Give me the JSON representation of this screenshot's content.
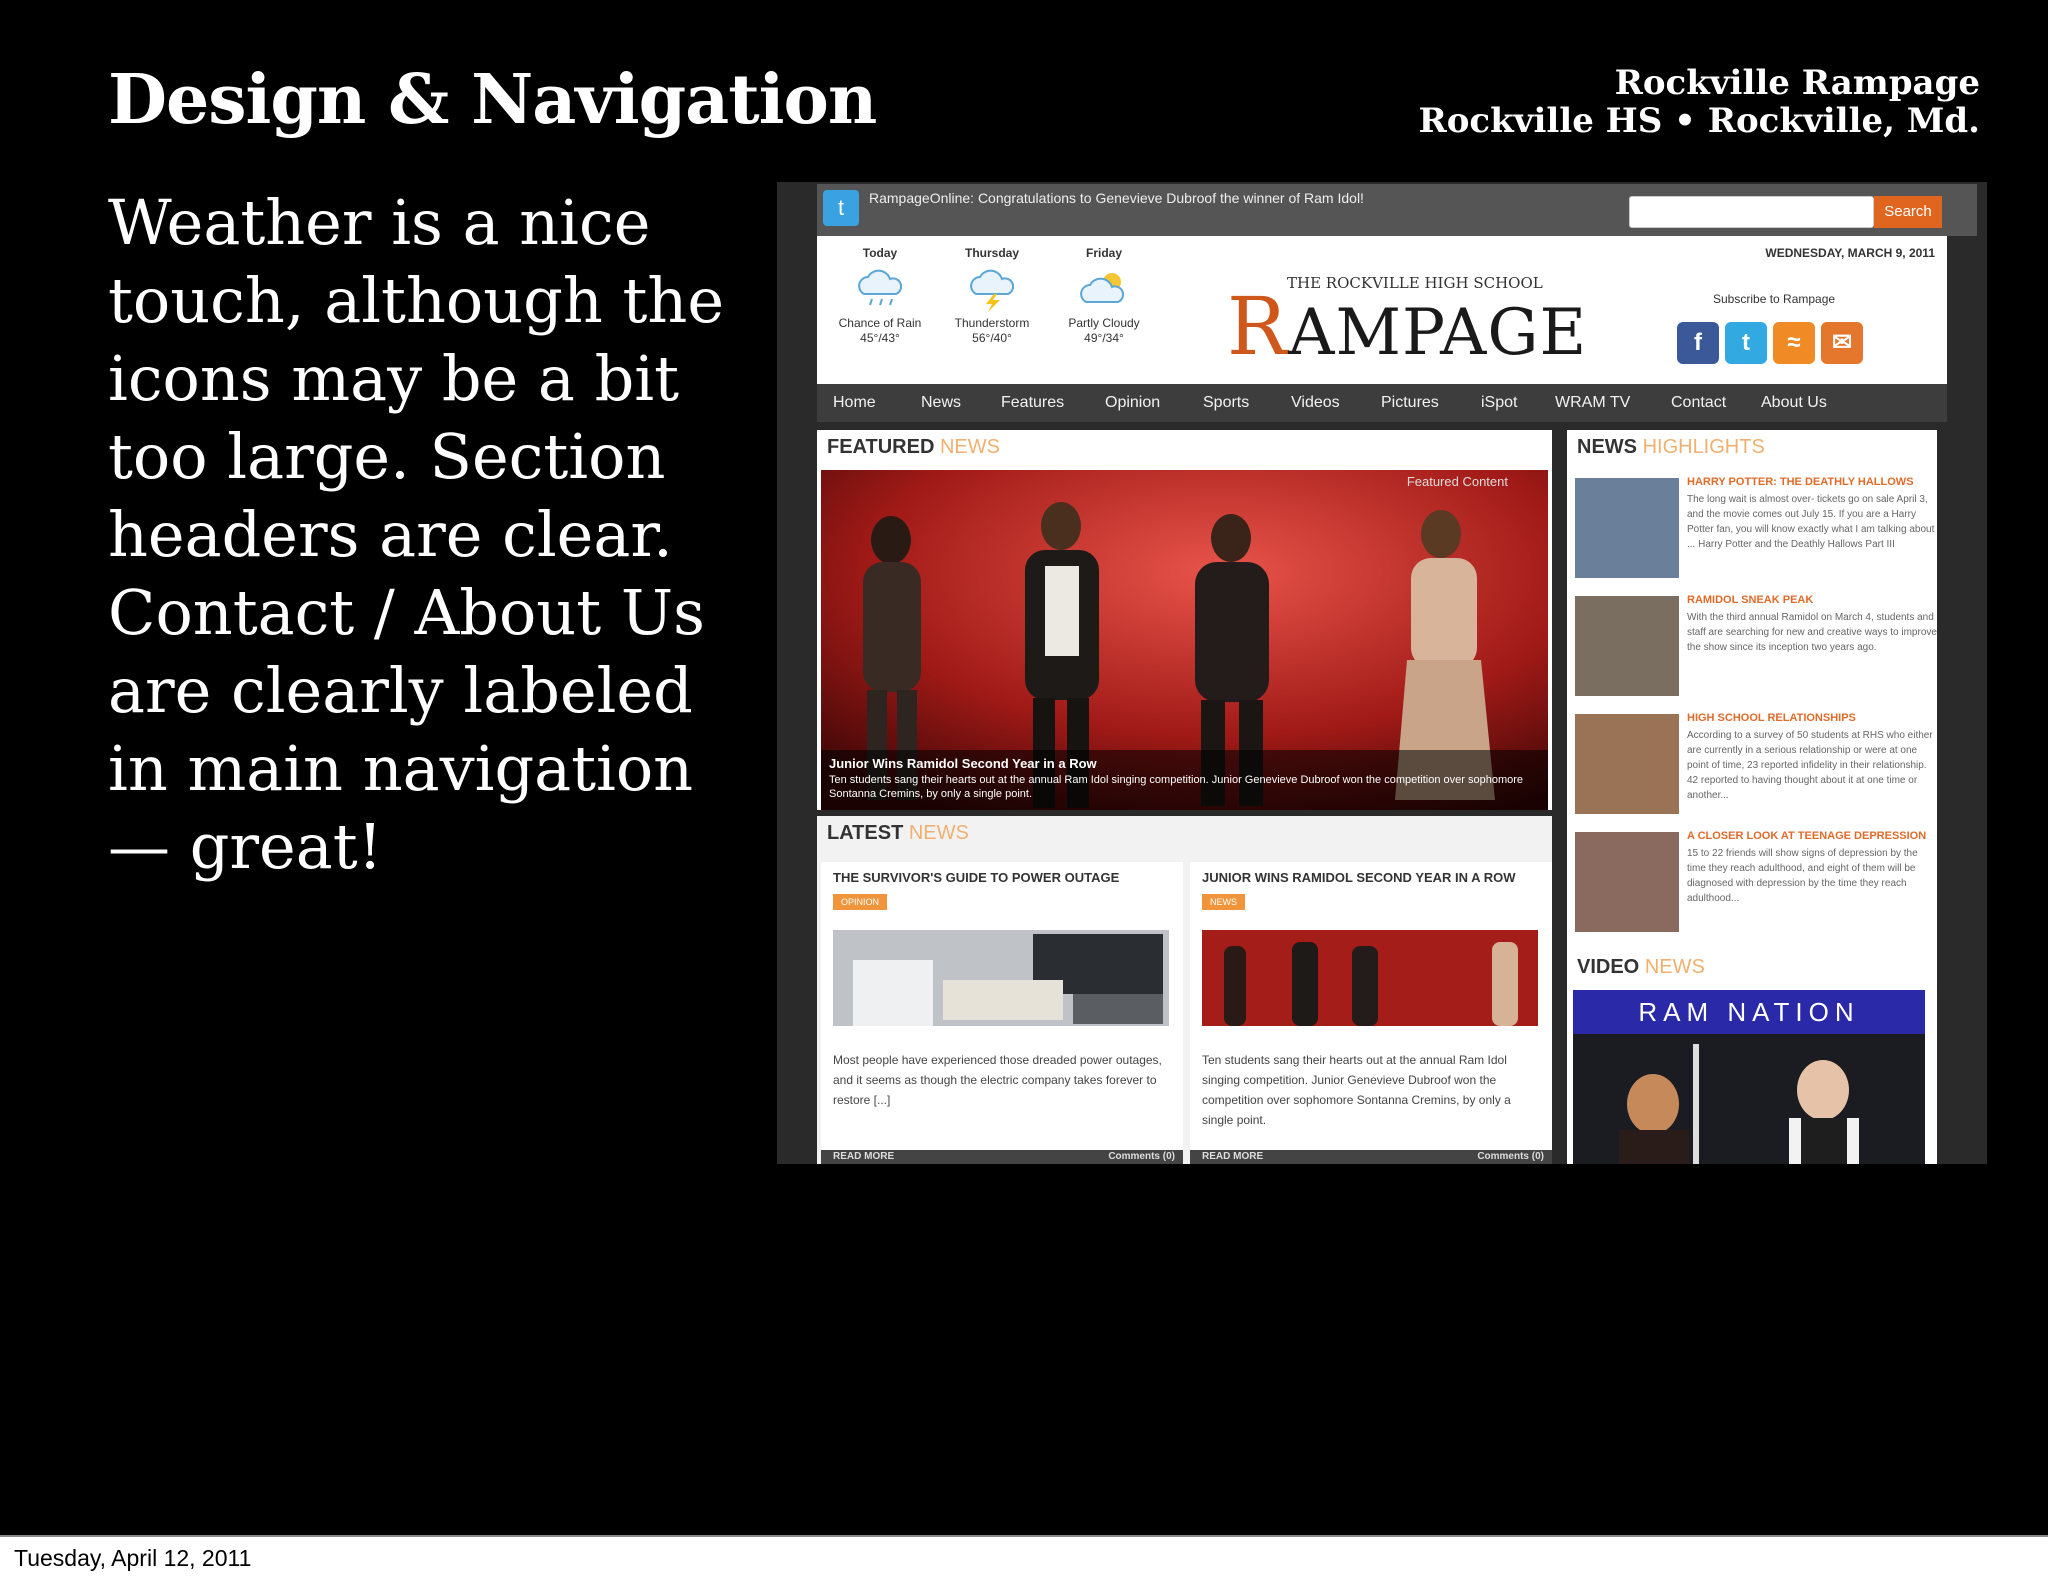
{
  "slide": {
    "title": "Design & Navigation",
    "source_line1": "Rockville Rampage",
    "source_line2": "Rockville HS • Rockville, Md.",
    "body": "Weather is a nice touch, although the icons may be a bit too large. Section headers are clear. Contact / About Us are clearly labeled in main navigation — great!",
    "footer_date": "Tuesday, April 12, 2011"
  },
  "site": {
    "twitter_text": "RampageOnline: Congratulations to Genevieve Dubroof the winner of Ram Idol!",
    "search_placeholder": "",
    "search_button": "Search",
    "date": "WEDNESDAY, MARCH 9, 2011",
    "logo_small": "THE ROCKVILLE HIGH SCHOOL",
    "logo_r": "R",
    "logo_rest": "AMPAGE",
    "subscribe_label": "Subscribe to Rampage",
    "social_icons": [
      "facebook-icon",
      "twitter-icon",
      "rss-icon",
      "email-icon"
    ],
    "weather": [
      {
        "day": "Today",
        "icon": "rain-cloud-icon",
        "desc": "Chance of Rain",
        "temp": "45°/43°"
      },
      {
        "day": "Thursday",
        "icon": "thunderstorm-icon",
        "desc": "Thunderstorm",
        "temp": "56°/40°"
      },
      {
        "day": "Friday",
        "icon": "partly-cloudy-icon",
        "desc": "Partly Cloudy",
        "temp": "49°/34°"
      }
    ],
    "nav": [
      "Home",
      "News",
      "Features",
      "Opinion",
      "Sports",
      "Videos",
      "Pictures",
      "iSpot",
      "WRAM TV",
      "Contact",
      "About Us"
    ],
    "featured": {
      "head_bold": "FEATURED",
      "head_accent": "NEWS",
      "tag": "Featured Content",
      "caption_title": "Junior Wins Ramidol Second Year in a Row",
      "caption_body": "Ten students sang their hearts out at the annual Ram Idol singing competition. Junior Genevieve Dubroof won the competition over sophomore Sontanna Cremins, by only a single point."
    },
    "latest": {
      "head_bold": "LATEST",
      "head_accent": "NEWS",
      "cards": [
        {
          "title": "THE SURVIVOR'S GUIDE TO POWER OUTAGE",
          "tag": "OPINION",
          "text": "Most people have experienced those dreaded power outages, and it seems as though the electric company takes forever to restore [...]",
          "read_more": "READ MORE",
          "comments": "Comments (0)"
        },
        {
          "title": "JUNIOR WINS RAMIDOL SECOND YEAR IN A ROW",
          "tag": "NEWS",
          "text": "Ten students sang their hearts out at the annual Ram Idol singing competition. Junior Genevieve Dubroof won the competition over sophomore Sontanna Cremins, by only a single point.",
          "read_more": "READ MORE",
          "comments": "Comments (0)"
        }
      ]
    },
    "highlights": {
      "head_bold": "NEWS",
      "head_accent": "HIGHLIGHTS",
      "items": [
        {
          "title": "HARRY POTTER: THE DEATHLY HALLOWS",
          "body": "The long wait is almost over- tickets go on sale April 3, and the movie comes out July 15. If you are a Harry Potter fan, you will know exactly what I am talking about ... Harry Potter and the Deathly Hallows Part III"
        },
        {
          "title": "RAMIDOL SNEAK PEAK",
          "body": "With the third annual Ramidol on March 4, students and staff are searching for new and creative ways to improve the show since its inception two years ago."
        },
        {
          "title": "HIGH SCHOOL RELATIONSHIPS",
          "body": "According to a survey of 50 students at RHS who either are currently in a serious relationship or were at one point of time, 23 reported infidelity in their relationship. 42 reported to having thought about it at one time or another..."
        },
        {
          "title": "A CLOSER LOOK AT TEENAGE DEPRESSION",
          "body": "15 to 22 friends will show signs of depression by the time they reach adulthood, and eight of them will be diagnosed with depression by the time they reach adulthood..."
        }
      ]
    },
    "video": {
      "head_bold": "VIDEO",
      "head_accent": "NEWS",
      "banner": "RAM NATION"
    }
  },
  "colors": {
    "accent_orange": "#e0661f",
    "nav_bg": "#3d3d3d",
    "slide_bg": "#000000"
  }
}
